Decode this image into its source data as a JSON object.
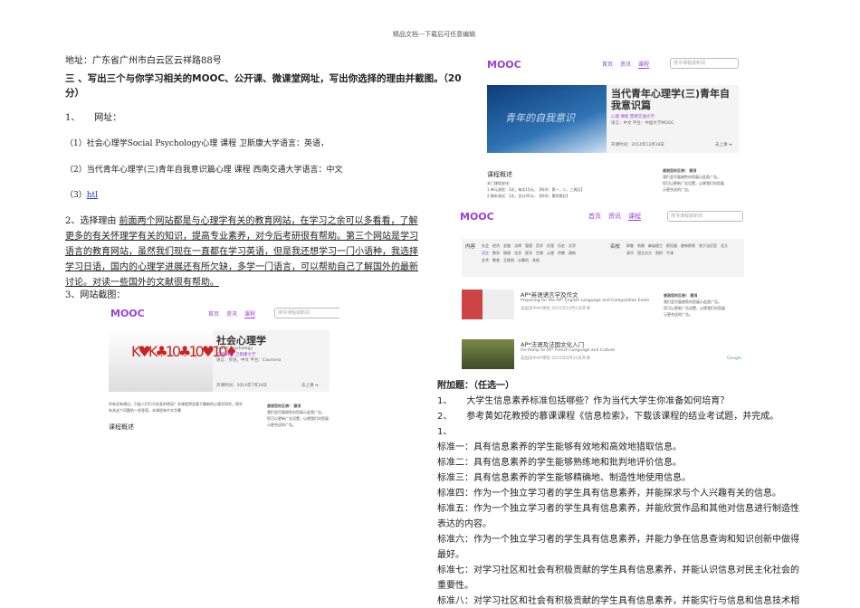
{
  "header_note": "精品文档---下载后可任意编辑",
  "left": {
    "address": "地址：广东省广州市白云区云祥路88号",
    "heading": "三 、写出三个与你学习相关的MOOC、公开课、微课堂网址，写出你选择的理由并截图。（20",
    "heading_cont": "分）",
    "item1": "1、     网址：",
    "site1": "（1）社会心理学Social Psychology心理 课程  卫斯康大学语言：英语，",
    "site2": "（2）当代青年心理学(三)青年自我意识篇心理 课程  西南交通大学语言：中文",
    "site3_prefix": "（3）",
    "site3_link": "htl",
    "reason_label": "2、选择理由  ",
    "reason_text": "前面两个网站都是与心理学有关的教育网站，在学习之余可以多看看，了解更多的有关怀理学有关的知识，提高专业素养，对今后考研很有帮助。第三个网站是学习语言的教育网站，虽然我们现在一直都在学习英语，但是我还想学习一门小语种，我选择学习日语，国内的心理学进展还有所欠缺，多学一门语言，可以帮助自己了解国外的最新讨论。对读一些国外的文献很有帮助。",
    "screenshot_label": "3、网站截图："
  },
  "mooc": {
    "logo": "MOOC",
    "nav": [
      "首页",
      "资讯",
      "课程"
    ],
    "search_placeholder": "搜寻课程或新闻",
    "go": "去上课 ➜",
    "course1": {
      "title": "社会心理学",
      "subtitle": "Social Psychology",
      "tags": "心理  课程  卫斯康大学",
      "lang": "语言：英语，中文    平台：Coursera",
      "date": "开课时间：2014年7月14日",
      "overview": "课程概述",
      "desc": "你有没有想过，引起人们行为本身的原因？本课程将会基于最新的心理学研究，探究有关这个问题的一些答案。本课程有中文字幕"
    },
    "course2": {
      "title": "当代青年心理学(三)青年自我意识篇",
      "tags": "心理  课程  西南交通大学",
      "lang": "语言：中文    平台：中国大学MOOC",
      "date": "开课时间：2014年12月18日",
      "overview": "课程概述",
      "desc": [
        "本门课程安排：",
        "1.单元测验：3次，每次15分。【时间：第一、二、三周后】",
        "2.期末测试：1次，总分45分。【时间：第四周后】"
      ],
      "banner_text": "青年的自我意识"
    },
    "ad": {
      "title": "感谢您的反馈！ 撤消",
      "line1": "我们会尽量避免向您展示此类广告。",
      "line2": "您可以更新广告设置，以便我们向您展示更合适的广告。"
    },
    "filter": {
      "content_label": "内容",
      "content": [
        "社会",
        "经济",
        "金融",
        "法律",
        "管理",
        "哲学",
        "伦理",
        "历史",
        "文学",
        "语言",
        "数学",
        "物理",
        "化学",
        "医学",
        "生物",
        "心理",
        "宗教",
        "建筑",
        "艺术",
        "教育",
        "互联网",
        "计算机",
        "其他"
      ],
      "school_label": "名校",
      "schools": [
        "耶鲁",
        "哈佛",
        "麻省理工",
        "斯坦福",
        "普林斯顿",
        "宾夕法尼亚",
        "北大",
        "清华",
        "国立台大",
        "剑桥",
        "牛津"
      ]
    },
    "list": [
      {
        "title": "AP*英语语言学及作文",
        "en": "Preparing for the AP* English Language and Composition Exam",
        "meta": "美国高中AP课程    2015年10月1日开课"
      },
      {
        "title": "AP*法语及法国文化入门",
        "en": "On-Ramp to AP* French Language and Culture",
        "meta": "美国高中AP课程    2015年8月10日开课"
      }
    ],
    "google": "Google"
  },
  "right": {
    "extra_title": "附加题：（任选一）",
    "q1": "1、     大学生信息素养标准包括哪些？作为当代大学生你准备如何培育？",
    "q2": "2、     参考黄如花教授的慕课课程《信息检索》，下载该课程的结业考试题，并完成。",
    "a_num": "1、",
    "standards": [
      "标准一：具有信息素养的学生能够有效地和高效地猎取信息。",
      "标准二：具有信息素养的学生能够熟练地和批判地评价信息。",
      "标准三：具有信息素养的学生能够精确地、制造性地使用信息。",
      "标准四：作为一个独立学习者的学生具有信息素养，并能探求与个人兴趣有关的信息。",
      "标准五：作为一个独立学习者的学生具有信息素养，并能欣赏作品和其他对信息进行制造性表达的内容。",
      "标准六：作为一个独立学习者的学生具有信息素养，并能力争在信息查询和知识创新中做得最好。",
      "标准七：对学习社区和社会有积极贡献的学生具有信息素养，并能认识信息对民主化社会的重要性。",
      "标准八：对学习社区和社会有积极贡献的学生具有信息素养，并能实行与信息和信息技术相关"
    ]
  }
}
